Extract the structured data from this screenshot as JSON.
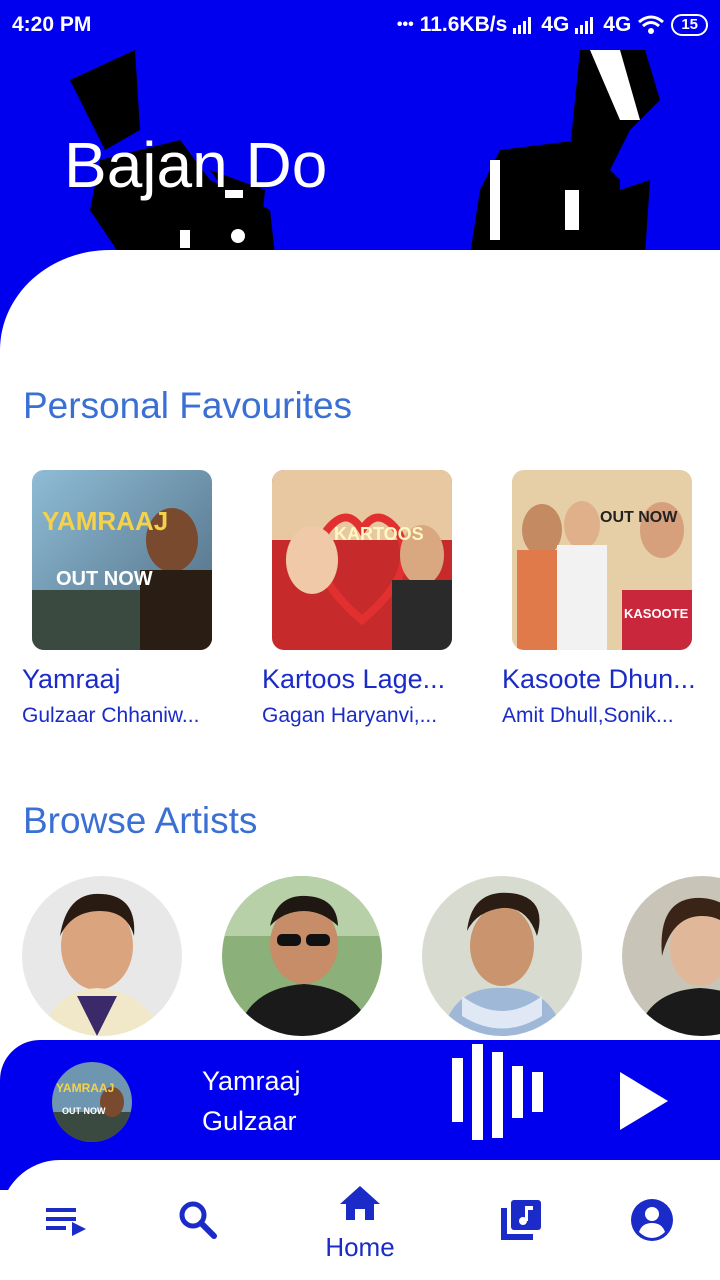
{
  "status_bar": {
    "time": "4:20 PM",
    "dots": "•••",
    "speed": "11.6KB/s",
    "network1": "4G",
    "network2": "4G",
    "battery": "15"
  },
  "app": {
    "title": "Bajan Do"
  },
  "favourites": {
    "title": "Personal Favourites",
    "songs": [
      {
        "title": "Yamraaj",
        "artist": "Gulzaar Chhaniw..."
      },
      {
        "title": "Kartoos Lage...",
        "artist": "Gagan Haryanvi,..."
      },
      {
        "title": "Kasoote Dhun...",
        "artist": "Amit Dhull,Sonik..."
      }
    ],
    "art_text": [
      "YAMRAAJ",
      "OUT NOW",
      "KARTOOS",
      "OUT NOW",
      "KASOOTE DHUNGE"
    ]
  },
  "artists": {
    "title": "Browse Artists"
  },
  "player": {
    "title": "Yamraaj",
    "artist": "Gulzaar",
    "thumb_text": "YAMRAAJ",
    "thumb_sub": "OUT NOW"
  },
  "nav": {
    "home_label": "Home"
  },
  "colors": {
    "primary": "#0000ee",
    "accent_text": "#1a2bc8",
    "section_title": "#3a6fd4"
  }
}
